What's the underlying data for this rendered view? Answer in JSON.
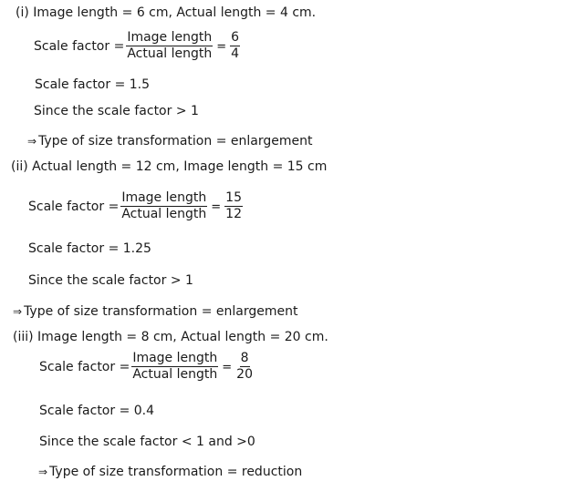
{
  "parts": [
    {
      "heading": "(i) Image length = 6 cm, Actual length = 4 cm.",
      "formula_label": "Scale factor = ",
      "numerator_label": "Image length",
      "denominator_label": "Actual length",
      "equals": "=",
      "value_numerator": "6",
      "value_denominator": "4",
      "result": "Scale factor = 1.5",
      "condition": "Since the scale factor > 1",
      "arrow": "⇒",
      "conclusion": "Type of size transformation = enlargement"
    },
    {
      "heading": "(ii) Actual length = 12 cm, Image length = 15 cm",
      "formula_label": "Scale factor = ",
      "numerator_label": "Image length",
      "denominator_label": "Actual length",
      "equals": "=",
      "value_numerator": "15",
      "value_denominator": "12",
      "result": "Scale factor = 1.25",
      "condition": "Since the scale factor > 1",
      "arrow": "⇒",
      "conclusion": "Type of size transformation = enlargement"
    },
    {
      "heading": "(iii) Image length = 8 cm, Actual length = 20 cm.",
      "formula_label": "Scale factor = ",
      "numerator_label": "Image length",
      "denominator_label": "Actual length",
      "equals": "=",
      "value_numerator": "8",
      "value_denominator": "20",
      "result": "Scale factor = 0.4",
      "condition": "Since the scale factor < 1 and >0",
      "arrow": "⇒",
      "conclusion": "Type of size transformation = reduction"
    }
  ]
}
